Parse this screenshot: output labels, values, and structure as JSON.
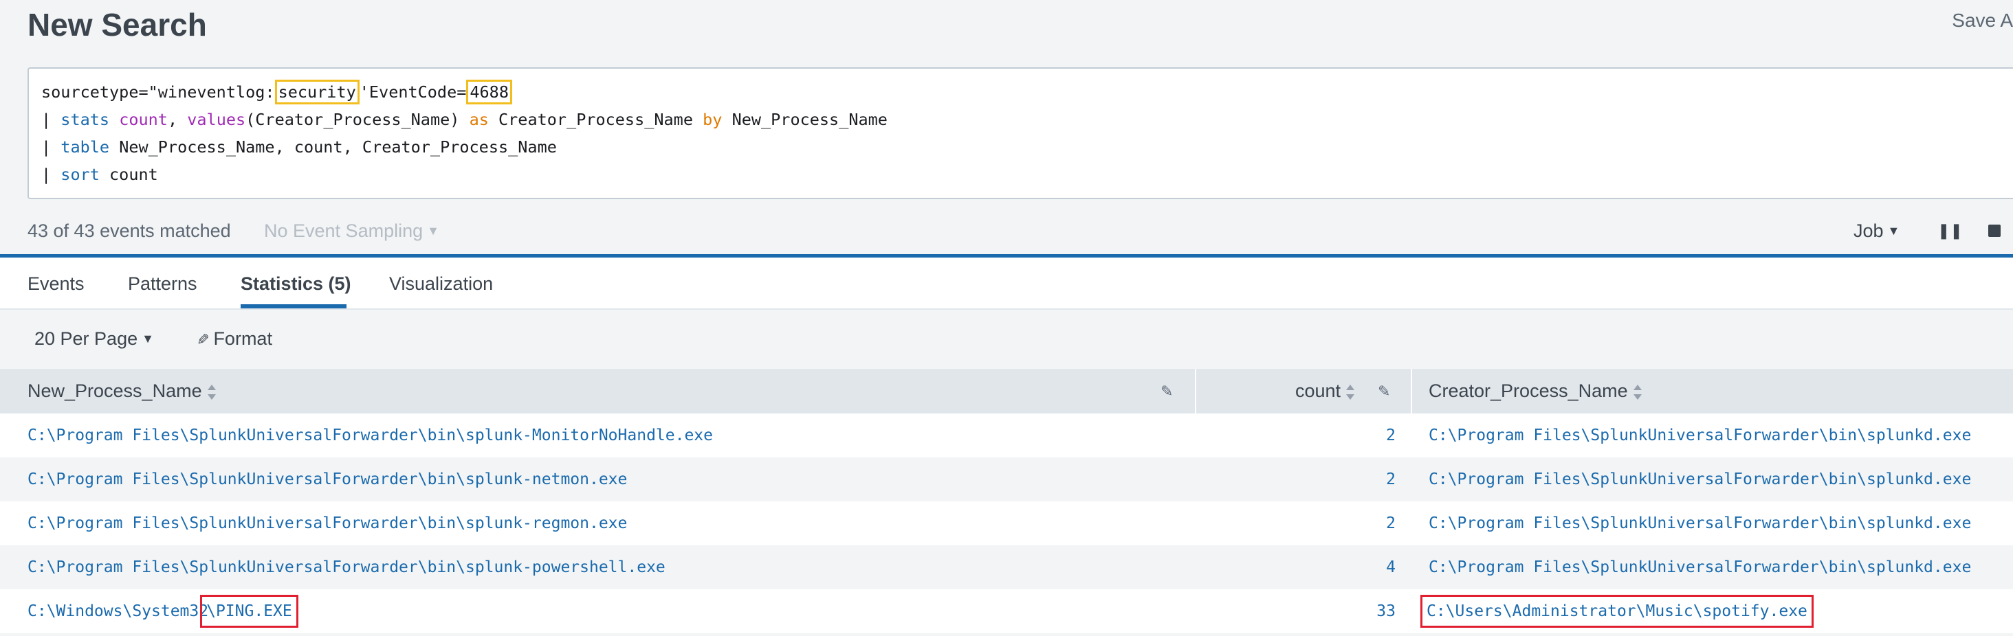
{
  "header": {
    "title": "New Search",
    "save_as": "Save A"
  },
  "search": {
    "line1": {
      "prefix": "sourcetype=\"wineventlog:",
      "hl1": "security",
      "middle": "'EventCode=",
      "hl2": "4688"
    },
    "line2": {
      "pipe": "| ",
      "cmd": "stats",
      "sp1": " ",
      "fn1": "count",
      "sp2": ", ",
      "fn2": "values",
      "arg": "(Creator_Process_Name) ",
      "kw_as": "as",
      "mid": " Creator_Process_Name ",
      "kw_by": "by",
      "tail": " New_Process_Name"
    },
    "line3": {
      "pipe": "| ",
      "cmd": "table",
      "tail": " New_Process_Name, count, Creator_Process_Name"
    },
    "line4": {
      "pipe": "| ",
      "cmd": "sort",
      "tail": " count"
    }
  },
  "job_bar": {
    "status": "43 of 43 events matched",
    "sampling": "No Event Sampling",
    "job_label": "Job",
    "pause_icon": "pause-icon",
    "stop_icon": "stop-icon"
  },
  "tabs": [
    {
      "label": "Events"
    },
    {
      "label": "Patterns"
    },
    {
      "label": "Statistics (5)"
    },
    {
      "label": "Visualization"
    }
  ],
  "toolbar": {
    "per_page": "20 Per Page",
    "format": "Format"
  },
  "table": {
    "columns": [
      "New_Process_Name",
      "count",
      "Creator_Process_Name"
    ],
    "rows": [
      {
        "new_process": "C:\\Program Files\\SplunkUniversalForwarder\\bin\\splunk-MonitorNoHandle.exe",
        "count": "2",
        "creator": "C:\\Program Files\\SplunkUniversalForwarder\\bin\\splunkd.exe"
      },
      {
        "new_process": "C:\\Program Files\\SplunkUniversalForwarder\\bin\\splunk-netmon.exe",
        "count": "2",
        "creator": "C:\\Program Files\\SplunkUniversalForwarder\\bin\\splunkd.exe"
      },
      {
        "new_process": "C:\\Program Files\\SplunkUniversalForwarder\\bin\\splunk-regmon.exe",
        "count": "2",
        "creator": "C:\\Program Files\\SplunkUniversalForwarder\\bin\\splunkd.exe"
      },
      {
        "new_process": "C:\\Program Files\\SplunkUniversalForwarder\\bin\\splunk-powershell.exe",
        "count": "4",
        "creator": "C:\\Program Files\\SplunkUniversalForwarder\\bin\\splunkd.exe"
      },
      {
        "new_process_prefix": "C:\\Windows\\System32",
        "new_process_hl": "\\PING.EXE",
        "count": "33",
        "creator": "C:\\Users\\Administrator\\Music\\spotify.exe"
      }
    ]
  },
  "colors": {
    "accent": "#1a6aad",
    "highlight_yellow": "#f2be1e",
    "highlight_red": "#e02030"
  }
}
